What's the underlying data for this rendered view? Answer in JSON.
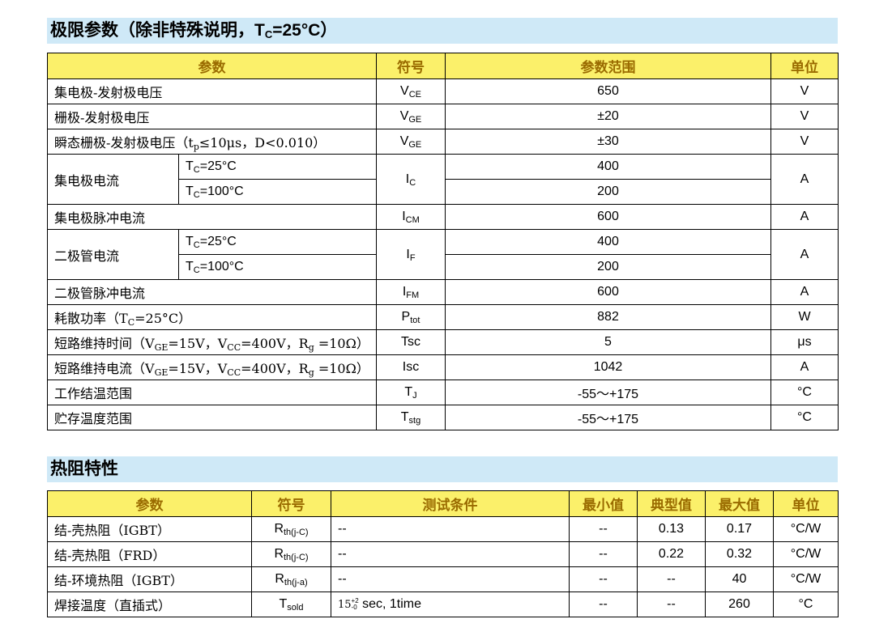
{
  "section1": {
    "title_a": "极限参数（除非特殊说明，T",
    "title_sub": "C",
    "title_b": "=25°C）",
    "headers": [
      "参数",
      "符号",
      "参数范围",
      "单位"
    ],
    "rows": {
      "vce": {
        "param": "集电极-发射极电压",
        "sym": "V",
        "sym_sub": "CE",
        "range": "650",
        "unit": "V"
      },
      "vge": {
        "param": "栅极-发射极电压",
        "sym": "V",
        "sym_sub": "GE",
        "range": "±20",
        "unit": "V"
      },
      "vge_t": {
        "param_a": "瞬态栅极-发射极电压（t",
        "param_sub": "p",
        "param_b": "≤10μs，D<0.010）",
        "sym": "V",
        "sym_sub": "GE",
        "range": "±30",
        "unit": "V"
      },
      "ic": {
        "param": "集电极电流",
        "cond1_a": "T",
        "cond1_sub": "C",
        "cond1_b": "=25°C",
        "cond2_a": "T",
        "cond2_sub": "C",
        "cond2_b": "=100°C",
        "sym": "I",
        "sym_sub": "C",
        "range1": "400",
        "range2": "200",
        "unit": "A"
      },
      "icm": {
        "param": "集电极脉冲电流",
        "sym": "I",
        "sym_sub": "CM",
        "range": "600",
        "unit": "A"
      },
      "if": {
        "param": "二极管电流",
        "cond1_a": "T",
        "cond1_sub": "C",
        "cond1_b": "=25°C",
        "cond2_a": "T",
        "cond2_sub": "C",
        "cond2_b": "=100°C",
        "sym": "I",
        "sym_sub": "F",
        "range1": "400",
        "range2": "200",
        "unit": "A"
      },
      "ifm": {
        "param": "二极管脉冲电流",
        "sym": "I",
        "sym_sub": "FM",
        "range": "600",
        "unit": "A"
      },
      "ptot": {
        "param_a": "耗散功率（T",
        "param_sub": "C",
        "param_b": "=25°C）",
        "sym": "P",
        "sym_sub": "tot",
        "range": "882",
        "unit": "W"
      },
      "tsc": {
        "param_a": "短路维持时间（V",
        "param_sub1": "GE",
        "param_b": "=15V，V",
        "param_sub2": "CC",
        "param_c": "=400V，R",
        "param_sub3": "g",
        "param_d": " =10Ω）",
        "sym": "Tsc",
        "range": "5",
        "unit": "μs"
      },
      "isc": {
        "param_a": "短路维持电流（V",
        "param_sub1": "GE",
        "param_b": "=15V，V",
        "param_sub2": "CC",
        "param_c": "=400V，R",
        "param_sub3": "g",
        "param_d": " =10Ω）",
        "sym": "Isc",
        "range": "1042",
        "unit": "A"
      },
      "tj": {
        "param": "工作结温范围",
        "sym": "T",
        "sym_sub": "J",
        "range": "-55～+175",
        "unit": "°C"
      },
      "tstg": {
        "param": "贮存温度范围",
        "sym": "T",
        "sym_sub": "stg",
        "range": "-55～+175",
        "unit": "°C"
      }
    }
  },
  "section2": {
    "title": "热阻特性",
    "headers": [
      "参数",
      "符号",
      "测试条件",
      "最小值",
      "典型值",
      "最大值",
      "单位"
    ],
    "rows": [
      {
        "param": "结-壳热阻（IGBT）",
        "sym": "R",
        "sym_sub": "th(j-C)",
        "cond": "--",
        "min": "--",
        "typ": "0.13",
        "max": "0.17",
        "unit": "°C/W"
      },
      {
        "param": "结-壳热阻（FRD）",
        "sym": "R",
        "sym_sub": "th(j-C)",
        "cond": "--",
        "min": "--",
        "typ": "0.22",
        "max": "0.32",
        "unit": "°C/W"
      },
      {
        "param": "结-环境热阻（IGBT）",
        "sym": "R",
        "sym_sub": "th(j-a)",
        "cond": "--",
        "min": "--",
        "typ": "--",
        "max": "40",
        "unit": "°C/W"
      },
      {
        "param": "焊接温度（直插式）",
        "sym": "T",
        "sym_sub": "sold",
        "cond_num": "15",
        "cond_sup": "+2",
        "cond_sub": "-0",
        "cond_rest": " sec, 1time",
        "min": "--",
        "typ": "--",
        "max": "260",
        "unit": "°C"
      }
    ]
  }
}
